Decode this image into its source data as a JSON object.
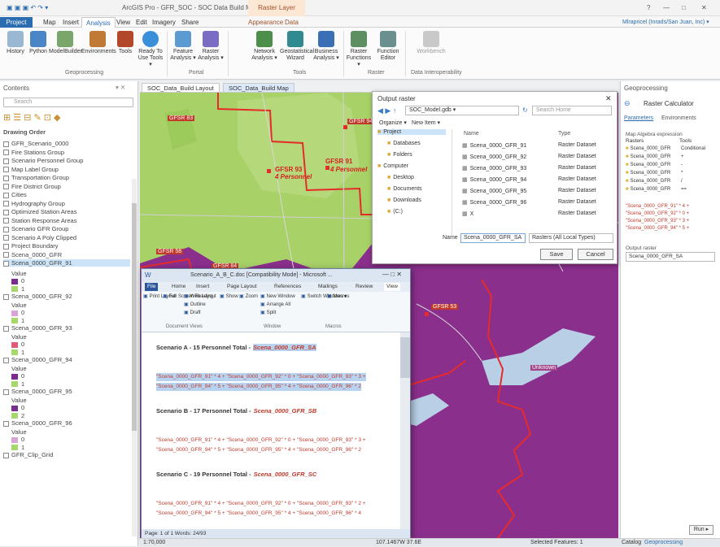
{
  "app": {
    "title": "ArcGIS Pro - GFR_SOC - SOC Data Build Map",
    "context_tab": "Raster Layer",
    "help": "?",
    "user": "Mlrapricel (Inrads/San Juan, Inc) ▾"
  },
  "tabs": [
    "Project",
    "Map",
    "Insert",
    "Analysis",
    "View",
    "Edit",
    "Imagery",
    "Share",
    "Appearance",
    "Data"
  ],
  "ribbon": {
    "buttons": [
      "History",
      "Python",
      "ModelBuilder",
      "Environments",
      "Tools",
      "Ready To Use Tools ▾",
      "Feature Analysis ▾",
      "Raster Analysis ▾",
      "Network Analysis ▾",
      "Geostatistical Wizard",
      "Business Analysis ▾",
      "Raster Functions ▾",
      "Function Editor",
      "Workbench"
    ],
    "groups": [
      "Geoprocessing",
      "Portal",
      "Tools",
      "Raster",
      "Data Interoperability"
    ]
  },
  "contents": {
    "title": "Contents",
    "search_placeholder": "Search",
    "drawing_order": "Drawing Order",
    "layers": [
      "GFR_Scenario_0000",
      "Fire Stations Group",
      "Scenario Personnel Group",
      "Map Label Group",
      "Transportation Group",
      "Fire District Group",
      "Cities",
      "Hydrography Group",
      "Optimized Station Areas",
      "Station Response Areas",
      "Scenario GFR Group",
      "Scenario A Poly Clipped",
      "Project Boundary",
      "Scena_0000_GFR",
      "Scena_0000_GFR_91"
    ],
    "value_label": "Value",
    "raster_groups": [
      {
        "name": "Scena_0000_GFR_91",
        "vals": [
          "0",
          "1"
        ],
        "colors": [
          "#7b2d8e",
          "#a6d86b"
        ]
      },
      {
        "name": "Scena_0000_GFR_92",
        "vals": [
          "0",
          "1"
        ],
        "colors": [
          "#d9a3d6",
          "#a6d86b"
        ]
      },
      {
        "name": "Scena_0000_GFR_93",
        "vals": [
          "0",
          "1"
        ],
        "colors": [
          "#e05b7a",
          "#a6d86b"
        ]
      },
      {
        "name": "Scena_0000_GFR_94",
        "vals": [
          "0",
          "1"
        ],
        "colors": [
          "#7b2d8e",
          "#a6d86b"
        ]
      },
      {
        "name": "Scena_0000_GFR_95",
        "vals": [
          "0",
          "2"
        ],
        "colors": [
          "#7b2d8e",
          "#a6d86b"
        ]
      },
      {
        "name": "Scena_0000_GFR_96",
        "vals": [
          "0",
          "1"
        ],
        "colors": [
          "#d9a3d6",
          "#a6d86b"
        ]
      }
    ],
    "last_layer": "GFR_Clip_Grid"
  },
  "map_tabs": [
    "SOC_Data_Build Layout",
    "SOC_Data_Build Map"
  ],
  "map": {
    "labels": [
      "GFSR 83",
      "GFSR 94",
      "GFSR 93",
      "4 Personnel",
      "GFSR 91",
      "4 Personnel",
      "GFSR 58",
      "GFSR 84",
      "GFSR 53",
      "Unknown"
    ]
  },
  "dialog": {
    "title": "Output raster",
    "path": "SOC_Model.gdb ▾",
    "search_placeholder": "Search Home",
    "organize": "Organize ▾",
    "new_item": "New Item ▾",
    "nav": [
      "Project",
      "Databases",
      "Folders",
      "Computer",
      "Desktop",
      "Documents",
      "Downloads",
      "(C:)"
    ],
    "col_name": "Name",
    "col_type": "Type",
    "items": [
      {
        "name": "Scena_0000_GFR_91",
        "type": "Raster Dataset"
      },
      {
        "name": "Scena_0000_GFR_92",
        "type": "Raster Dataset"
      },
      {
        "name": "Scena_0000_GFR_93",
        "type": "Raster Dataset"
      },
      {
        "name": "Scena_0000_GFR_94",
        "type": "Raster Dataset"
      },
      {
        "name": "Scena_0000_GFR_95",
        "type": "Raster Dataset"
      },
      {
        "name": "Scena_0000_GFR_96",
        "type": "Raster Dataset"
      },
      {
        "name": "X",
        "type": "Raster Dataset"
      }
    ],
    "name_label": "Name",
    "name_value": "Scena_0000_GFR_SA",
    "filter": "Rasters (All Local Types)",
    "save": "Save",
    "cancel": "Cancel"
  },
  "geo": {
    "title": "Geoprocessing",
    "tool": "Raster Calculator",
    "tab_params": "Parameters",
    "tab_env": "Environments",
    "expr_label": "Map Algebra expression",
    "rasters_label": "Rasters",
    "tools_label": "Tools",
    "rasters": [
      "Scena_0000_GFR",
      "Scena_0000_GFR",
      "Scena_0000_GFR",
      "Scena_0000_GFR",
      "Scena_0000_GFR",
      "Scena_0000_GFR"
    ],
    "tools": [
      "Conditional",
      "+",
      "-",
      "*",
      "/",
      "=="
    ],
    "expr": [
      "\"Scena_0000_GFR_91\" * 4 +",
      "\"Scena_0000_GFR_92\" * 0 +",
      "\"Scena_0000_GFR_93\" * 3 +",
      "\"Scena_0000_GFR_94\" * 5 +"
    ],
    "output_label": "Output raster",
    "output_value": "Scena_0000_GFR_SA",
    "run": "Run ▸"
  },
  "word": {
    "title": "Scenario_A_B_C.doc [Compatibility Mode] - Microsoft ...",
    "tabs": [
      "File",
      "Home",
      "Insert",
      "Page Layout",
      "References",
      "Mailings",
      "Review",
      "View"
    ],
    "buttons": [
      "Print Layout",
      "Full Screen Reading",
      "Web Layout",
      "Outline",
      "Draft",
      "Show",
      "Zoom",
      "New Window",
      "Arrange All",
      "Split",
      "Switch Windows ▾",
      "Macros"
    ],
    "groups": [
      "Document Views",
      "Window",
      "Macros"
    ],
    "sections": [
      {
        "heading": "Scenario A - 15 Personnel Total -",
        "name": "Scena_0000_GFR_SA",
        "lines": [
          "\"Scena_0000_GFR_91\" * 4 + \"Scena_0000_GFR_92\" * 0 + \"Scena_0000_GFR_93\" * 3 +",
          "\"Scena_0000_GFR_94\" * 5 + \"Scena_0000_GFR_95\" * 4 + \"Scena_0000_GFR_96\" * 2"
        ]
      },
      {
        "heading": "Scenario B - 17 Personnel Total -",
        "name": "Scena_0000_GFR_SB",
        "lines": [
          "\"Scena_0000_GFR_91\" * 4 + \"Scena_0000_GFR_92\" * 0 + \"Scena_0000_GFR_93\" * 3 +",
          "\"Scena_0000_GFR_94\" * 5 + \"Scena_0000_GFR_95\" * 4 + \"Scena_0000_GFR_96\" * 2"
        ]
      },
      {
        "heading": "Scenario C - 19 Personnel Total -",
        "name": "Scena_0000_GFR_SC",
        "lines": [
          "\"Scena_0000_GFR_91\" * 4 + \"Scena_0000_GFR_92\" * 0 + \"Scena_0000_GFR_93\" * 2 +",
          "\"Scena_0000_GFR_94\" * 5 + \"Scena_0000_GFR_95\" * 4 + \"Scena_0000_GFR_96\" * 4"
        ]
      }
    ],
    "status": "Page: 1 of 1   Words: 24/93"
  },
  "status": {
    "scale": "1:70,000",
    "coords": "107.1467W 37.6E",
    "selected": "Selected Features: 1",
    "tab_catalog": "Catalog",
    "tab_geo": "Geoprocessing"
  }
}
